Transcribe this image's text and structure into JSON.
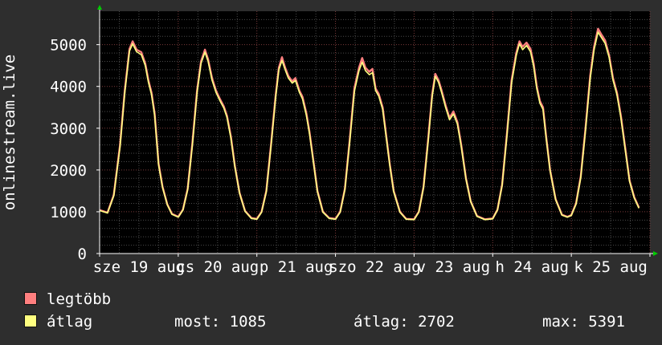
{
  "chart_data": {
    "type": "line",
    "ylabel": "onlinestream.live",
    "ylim": [
      0,
      5800
    ],
    "yticks": [
      0,
      1000,
      2000,
      3000,
      4000,
      5000
    ],
    "xticks": [
      "sze 19 aug",
      "cs 20 aug",
      "p 21 aug",
      "szo 22 aug",
      "v 23 aug",
      "h 24 aug",
      "k 25 aug"
    ],
    "xrange_days": 7,
    "series": [
      {
        "name": "legtöbb",
        "color": "#ff7f7f",
        "points": [
          [
            0.0,
            1040
          ],
          [
            0.1,
            980
          ],
          [
            0.18,
            1400
          ],
          [
            0.26,
            2600
          ],
          [
            0.32,
            3900
          ],
          [
            0.38,
            4900
          ],
          [
            0.42,
            5080
          ],
          [
            0.47,
            4880
          ],
          [
            0.53,
            4820
          ],
          [
            0.58,
            4550
          ],
          [
            0.62,
            4150
          ],
          [
            0.66,
            3850
          ],
          [
            0.7,
            3350
          ],
          [
            0.75,
            2150
          ],
          [
            0.8,
            1600
          ],
          [
            0.86,
            1180
          ],
          [
            0.92,
            950
          ],
          [
            1.0,
            880
          ],
          [
            1.06,
            1050
          ],
          [
            1.12,
            1550
          ],
          [
            1.18,
            2650
          ],
          [
            1.24,
            3900
          ],
          [
            1.29,
            4600
          ],
          [
            1.34,
            4880
          ],
          [
            1.38,
            4650
          ],
          [
            1.43,
            4200
          ],
          [
            1.48,
            3900
          ],
          [
            1.53,
            3700
          ],
          [
            1.58,
            3520
          ],
          [
            1.62,
            3300
          ],
          [
            1.67,
            2800
          ],
          [
            1.72,
            2100
          ],
          [
            1.78,
            1450
          ],
          [
            1.85,
            1020
          ],
          [
            1.93,
            850
          ],
          [
            2.0,
            830
          ],
          [
            2.06,
            1000
          ],
          [
            2.12,
            1500
          ],
          [
            2.18,
            2600
          ],
          [
            2.24,
            3800
          ],
          [
            2.28,
            4450
          ],
          [
            2.32,
            4700
          ],
          [
            2.36,
            4450
          ],
          [
            2.4,
            4250
          ],
          [
            2.45,
            4120
          ],
          [
            2.49,
            4200
          ],
          [
            2.54,
            3900
          ],
          [
            2.58,
            3750
          ],
          [
            2.63,
            3350
          ],
          [
            2.67,
            2900
          ],
          [
            2.72,
            2200
          ],
          [
            2.77,
            1500
          ],
          [
            2.84,
            1000
          ],
          [
            2.92,
            850
          ],
          [
            3.0,
            830
          ],
          [
            3.06,
            1000
          ],
          [
            3.12,
            1550
          ],
          [
            3.18,
            2700
          ],
          [
            3.24,
            3950
          ],
          [
            3.3,
            4450
          ],
          [
            3.34,
            4680
          ],
          [
            3.38,
            4450
          ],
          [
            3.43,
            4350
          ],
          [
            3.47,
            4420
          ],
          [
            3.51,
            3950
          ],
          [
            3.55,
            3820
          ],
          [
            3.6,
            3500
          ],
          [
            3.64,
            2900
          ],
          [
            3.69,
            2150
          ],
          [
            3.74,
            1500
          ],
          [
            3.82,
            1000
          ],
          [
            3.9,
            830
          ],
          [
            4.0,
            820
          ],
          [
            4.06,
            1000
          ],
          [
            4.12,
            1600
          ],
          [
            4.18,
            2750
          ],
          [
            4.23,
            3800
          ],
          [
            4.27,
            4300
          ],
          [
            4.31,
            4150
          ],
          [
            4.35,
            3900
          ],
          [
            4.4,
            3550
          ],
          [
            4.45,
            3250
          ],
          [
            4.5,
            3400
          ],
          [
            4.55,
            3150
          ],
          [
            4.6,
            2600
          ],
          [
            4.66,
            1800
          ],
          [
            4.72,
            1250
          ],
          [
            4.8,
            900
          ],
          [
            4.9,
            820
          ],
          [
            5.0,
            840
          ],
          [
            5.06,
            1050
          ],
          [
            5.12,
            1650
          ],
          [
            5.18,
            2850
          ],
          [
            5.24,
            4150
          ],
          [
            5.3,
            4800
          ],
          [
            5.34,
            5080
          ],
          [
            5.38,
            4950
          ],
          [
            5.43,
            5050
          ],
          [
            5.48,
            4900
          ],
          [
            5.52,
            4550
          ],
          [
            5.56,
            4000
          ],
          [
            5.6,
            3650
          ],
          [
            5.64,
            3500
          ],
          [
            5.68,
            2800
          ],
          [
            5.73,
            2000
          ],
          [
            5.8,
            1300
          ],
          [
            5.88,
            930
          ],
          [
            5.95,
            880
          ],
          [
            6.0,
            920
          ],
          [
            6.06,
            1200
          ],
          [
            6.12,
            1850
          ],
          [
            6.18,
            3000
          ],
          [
            6.24,
            4250
          ],
          [
            6.29,
            4950
          ],
          [
            6.34,
            5380
          ],
          [
            6.38,
            5250
          ],
          [
            6.43,
            5100
          ],
          [
            6.48,
            4750
          ],
          [
            6.53,
            4200
          ],
          [
            6.58,
            3850
          ],
          [
            6.63,
            3300
          ],
          [
            6.68,
            2600
          ],
          [
            6.74,
            1750
          ],
          [
            6.8,
            1350
          ],
          [
            6.86,
            1100
          ]
        ]
      },
      {
        "name": "átlag",
        "color": "#ffff80",
        "points": [
          [
            0.0,
            1030
          ],
          [
            0.1,
            970
          ],
          [
            0.18,
            1380
          ],
          [
            0.26,
            2550
          ],
          [
            0.32,
            3850
          ],
          [
            0.38,
            4850
          ],
          [
            0.42,
            5020
          ],
          [
            0.47,
            4830
          ],
          [
            0.53,
            4760
          ],
          [
            0.58,
            4500
          ],
          [
            0.62,
            4100
          ],
          [
            0.66,
            3800
          ],
          [
            0.7,
            3300
          ],
          [
            0.75,
            2120
          ],
          [
            0.8,
            1580
          ],
          [
            0.86,
            1170
          ],
          [
            0.92,
            940
          ],
          [
            1.0,
            870
          ],
          [
            1.06,
            1040
          ],
          [
            1.12,
            1530
          ],
          [
            1.18,
            2600
          ],
          [
            1.24,
            3850
          ],
          [
            1.29,
            4550
          ],
          [
            1.34,
            4820
          ],
          [
            1.38,
            4600
          ],
          [
            1.43,
            4150
          ],
          [
            1.48,
            3860
          ],
          [
            1.53,
            3660
          ],
          [
            1.58,
            3480
          ],
          [
            1.62,
            3260
          ],
          [
            1.67,
            2760
          ],
          [
            1.72,
            2080
          ],
          [
            1.78,
            1440
          ],
          [
            1.85,
            1010
          ],
          [
            1.93,
            840
          ],
          [
            2.0,
            820
          ],
          [
            2.06,
            990
          ],
          [
            2.12,
            1480
          ],
          [
            2.18,
            2560
          ],
          [
            2.24,
            3750
          ],
          [
            2.28,
            4400
          ],
          [
            2.32,
            4620
          ],
          [
            2.36,
            4400
          ],
          [
            2.4,
            4200
          ],
          [
            2.45,
            4080
          ],
          [
            2.49,
            4140
          ],
          [
            2.54,
            3860
          ],
          [
            2.58,
            3700
          ],
          [
            2.63,
            3300
          ],
          [
            2.67,
            2860
          ],
          [
            2.72,
            2170
          ],
          [
            2.77,
            1480
          ],
          [
            2.84,
            990
          ],
          [
            2.92,
            840
          ],
          [
            3.0,
            820
          ],
          [
            3.06,
            990
          ],
          [
            3.12,
            1530
          ],
          [
            3.18,
            2650
          ],
          [
            3.24,
            3880
          ],
          [
            3.3,
            4380
          ],
          [
            3.34,
            4580
          ],
          [
            3.38,
            4380
          ],
          [
            3.43,
            4280
          ],
          [
            3.47,
            4330
          ],
          [
            3.51,
            3900
          ],
          [
            3.55,
            3770
          ],
          [
            3.6,
            3450
          ],
          [
            3.64,
            2860
          ],
          [
            3.69,
            2120
          ],
          [
            3.74,
            1480
          ],
          [
            3.82,
            990
          ],
          [
            3.9,
            820
          ],
          [
            4.0,
            810
          ],
          [
            4.06,
            990
          ],
          [
            4.12,
            1580
          ],
          [
            4.18,
            2700
          ],
          [
            4.23,
            3750
          ],
          [
            4.27,
            4240
          ],
          [
            4.31,
            4100
          ],
          [
            4.35,
            3850
          ],
          [
            4.4,
            3500
          ],
          [
            4.45,
            3200
          ],
          [
            4.5,
            3340
          ],
          [
            4.55,
            3100
          ],
          [
            4.6,
            2560
          ],
          [
            4.66,
            1780
          ],
          [
            4.72,
            1240
          ],
          [
            4.8,
            890
          ],
          [
            4.9,
            810
          ],
          [
            5.0,
            830
          ],
          [
            5.06,
            1040
          ],
          [
            5.12,
            1630
          ],
          [
            5.18,
            2800
          ],
          [
            5.24,
            4080
          ],
          [
            5.3,
            4740
          ],
          [
            5.34,
            5020
          ],
          [
            5.38,
            4880
          ],
          [
            5.43,
            4980
          ],
          [
            5.48,
            4830
          ],
          [
            5.52,
            4480
          ],
          [
            5.56,
            3950
          ],
          [
            5.6,
            3600
          ],
          [
            5.64,
            3450
          ],
          [
            5.68,
            2760
          ],
          [
            5.73,
            1980
          ],
          [
            5.8,
            1290
          ],
          [
            5.88,
            920
          ],
          [
            5.95,
            870
          ],
          [
            6.0,
            910
          ],
          [
            6.06,
            1180
          ],
          [
            6.12,
            1820
          ],
          [
            6.18,
            2950
          ],
          [
            6.24,
            4180
          ],
          [
            6.29,
            4880
          ],
          [
            6.34,
            5300
          ],
          [
            6.38,
            5180
          ],
          [
            6.43,
            5030
          ],
          [
            6.48,
            4700
          ],
          [
            6.53,
            4150
          ],
          [
            6.58,
            3800
          ],
          [
            6.63,
            3250
          ],
          [
            6.68,
            2560
          ],
          [
            6.74,
            1730
          ],
          [
            6.8,
            1330
          ],
          [
            6.86,
            1085
          ]
        ]
      }
    ]
  },
  "legend": {
    "max_label": "legtöbb",
    "avg_label": "átlag",
    "max_color": "#ff7f7f",
    "avg_color": "#ffff80"
  },
  "stats": {
    "now": "most: 1085",
    "avg": "átlag: 2702",
    "max": "max: 5391"
  }
}
